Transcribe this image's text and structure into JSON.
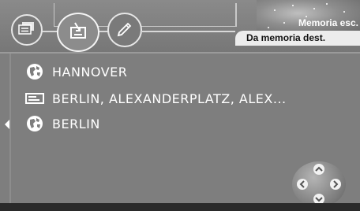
{
  "header": {
    "memory_write_label": "Memoria esc.",
    "memory_dest_label": "Da memoria dest."
  },
  "toolbar": {
    "buttons": [
      {
        "icon": "list-icon"
      },
      {
        "icon": "import-icon"
      },
      {
        "icon": "pencil-icon"
      }
    ]
  },
  "destinations": [
    {
      "icon": "globe-icon",
      "label": "HANNOVER"
    },
    {
      "icon": "address-card-icon",
      "label": "BERLIN, ALEXANDERPLATZ, ALEX..."
    },
    {
      "icon": "globe-icon",
      "label": "BERLIN"
    }
  ],
  "colors": {
    "background": "#7e7e7e",
    "text": "#ffffff",
    "tab_background": "#ececec"
  }
}
